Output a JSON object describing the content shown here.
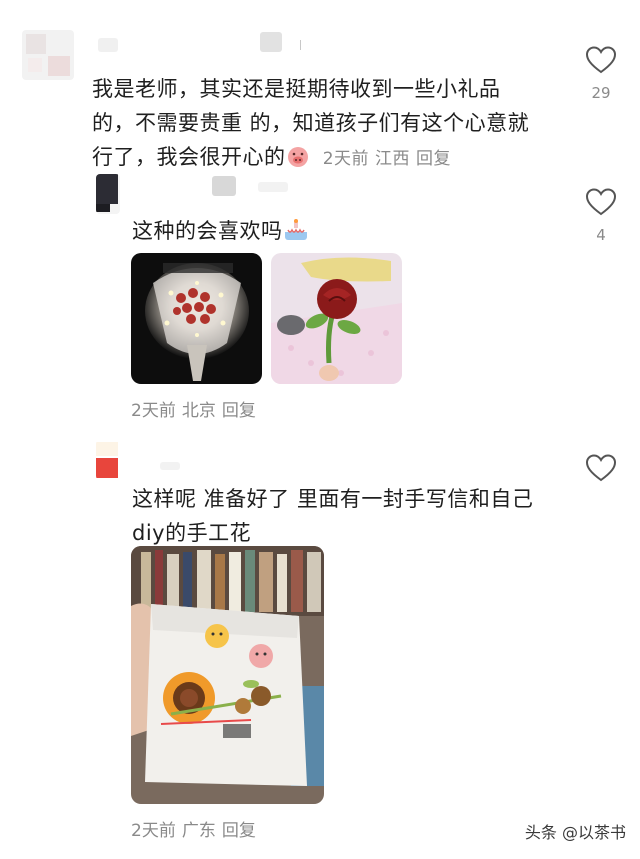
{
  "comments": [
    {
      "text_line1": "我是老师，其实还是挺期待收到一些小礼品",
      "text_line2": "的，不需要贵重 的，知道孩子们有这个心意就",
      "text_line3": "行了，我会很开心的",
      "emoji": "pig-face-emoji",
      "time": "2天前",
      "location": "江西",
      "reply_label": "回复",
      "likes": "29"
    },
    {
      "text": "这种的会喜欢吗",
      "emoji": "cake-emoji",
      "time": "2天前",
      "location": "北京",
      "reply_label": "回复",
      "likes": "4",
      "photos": [
        "bouquet-photo",
        "crochet-rose-photo"
      ]
    },
    {
      "text_line1": "这样呢 准备好了 里面有一封手写信和自己",
      "text_line2": "diy的手工花",
      "time": "2天前",
      "location": "广东",
      "reply_label": "回复",
      "photos": [
        "gift-bag-photo"
      ]
    }
  ],
  "watermark": "头条 @以茶书",
  "colors": {
    "meta": "#8a8a8a",
    "text": "#1f1f1f",
    "accent_red": "#e8453c"
  }
}
